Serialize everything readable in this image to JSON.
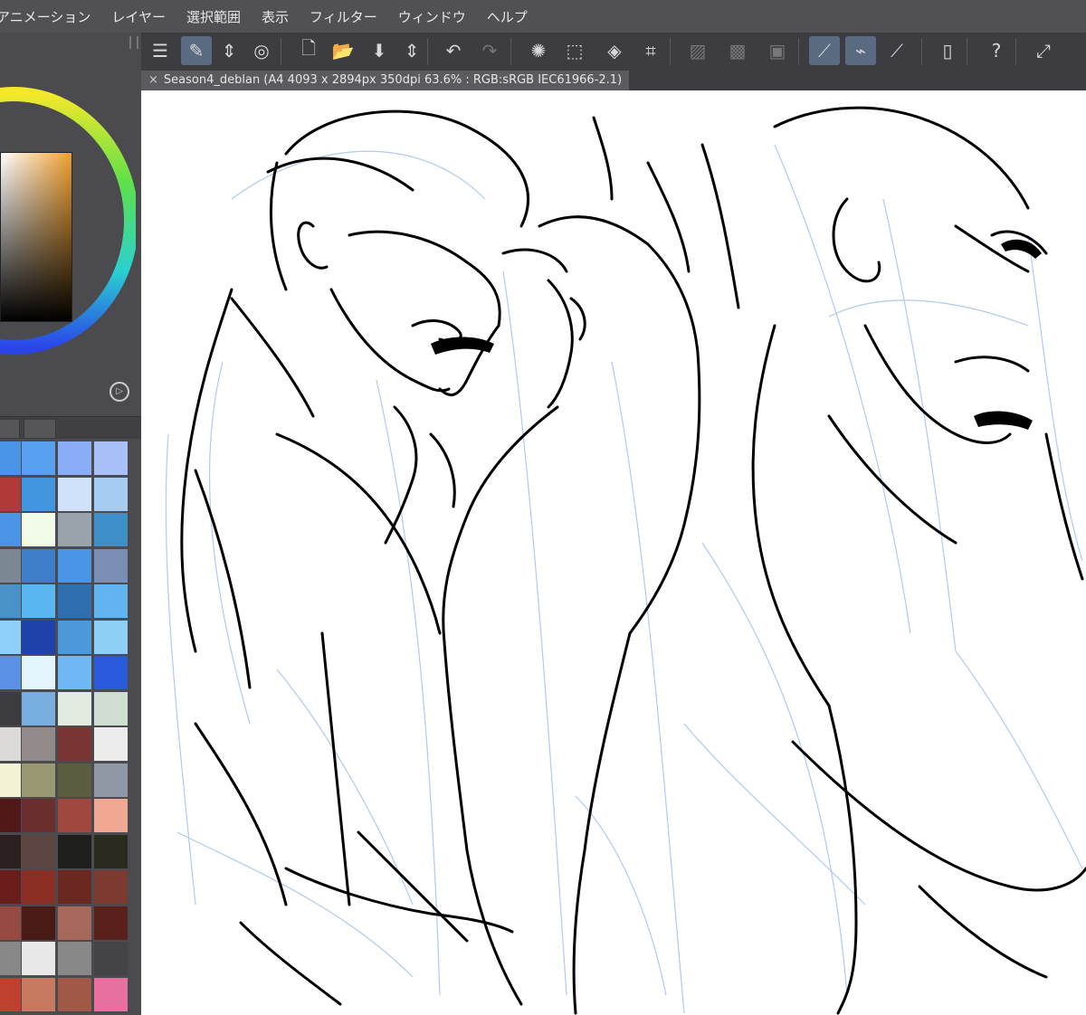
{
  "menubar": {
    "items": [
      "アニメーション",
      "レイヤー",
      "選択範囲",
      "表示",
      "フィルター",
      "ウィンドウ",
      "ヘルプ"
    ]
  },
  "color_panel": {
    "r": "255",
    "g": "247",
    "b": "235",
    "g_color": "#3cb043",
    "b_color": "#1a4ad6"
  },
  "document": {
    "tab_title": "Season4_deblan (A4 4093 x 2894px 350dpi 63.6% : RGB:sRGB IEC61966-2.1)",
    "close_glyph": "×"
  },
  "toolbar": {
    "icons": [
      "menu-icon",
      "pen-select-icon",
      "stepper-icon",
      "layer-ring-icon",
      "new-file-icon",
      "open-folder-icon",
      "save-icon",
      "stepper-icon",
      "undo-icon",
      "redo-icon",
      "spinner-icon",
      "select-dotted-icon",
      "fill-bucket-icon",
      "transform-icon",
      "hatch-box-icon",
      "grid-box-icon",
      "dashed-box-icon",
      "snap-ruler-icon",
      "snap-brush-icon",
      "snap-line-icon",
      "tablet-icon",
      "help-bubble-icon",
      "fullscreen-icon"
    ]
  },
  "palette_colors": [
    [
      "#4a94e8",
      "#5aa0f0",
      "#8aaef5",
      "#a8c0f8"
    ],
    [
      "#b03a3a",
      "#4296e0",
      "#cfe2fa",
      "#a7ccf2"
    ],
    [
      "#4b93e6",
      "#f2fae8",
      "#9aa3ac",
      "#3e8ec8"
    ],
    [
      "#7b8894",
      "#3c7fc8",
      "#4a95e6",
      "#7a8eb4"
    ],
    [
      "#4892c8",
      "#5ab6f0",
      "#2f6fb0",
      "#62b4f0"
    ],
    [
      "#8ed0f8",
      "#1e42aa",
      "#4d98d8",
      "#8ecff6"
    ],
    [
      "#5c92e6",
      "#e4f4fc",
      "#6fb8f4",
      "#2a5adc"
    ],
    [
      "#3c3c3e",
      "#78aee0",
      "#e2ebe0",
      "#cfdcd0"
    ],
    [
      "#dcdad8",
      "#928a88",
      "#7a3432",
      "#ebebeb"
    ],
    [
      "#f4f2d4",
      "#9a9872",
      "#5c5c40",
      "#9098a6"
    ],
    [
      "#501818",
      "#6a2e2e",
      "#a04840",
      "#f0a892"
    ],
    [
      "#2c2020",
      "#5c4440",
      "#1e1e1c",
      "#2a2a1e"
    ],
    [
      "#6a1e1c",
      "#8a2e26",
      "#6a2820",
      "#7c3a30"
    ],
    [
      "#964a42",
      "#4a1a16",
      "#a8685c",
      "#5a201c"
    ],
    [
      "#888888",
      "#e8e8e8",
      "#888888",
      "#444446"
    ],
    [
      "#c04030",
      "#c87a60",
      "#a05848",
      "#e870a0"
    ]
  ]
}
